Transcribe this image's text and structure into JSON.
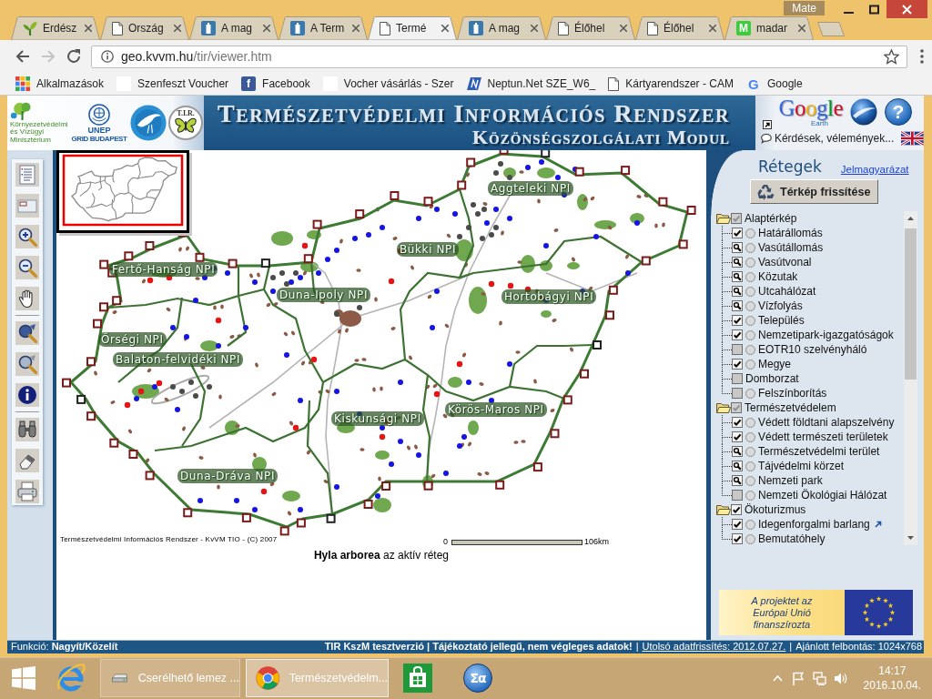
{
  "browser": {
    "user": "Mate",
    "tabs": [
      {
        "title": "Erdész",
        "kind": "sprout",
        "selected": false
      },
      {
        "title": "Ország",
        "kind": "document",
        "selected": false
      },
      {
        "title": "A mag",
        "kind": "statue",
        "selected": false
      },
      {
        "title": "A Term",
        "kind": "statue",
        "selected": false
      },
      {
        "title": "Termé",
        "kind": "document",
        "selected": true
      },
      {
        "title": "A mag",
        "kind": "statue",
        "selected": false
      },
      {
        "title": "Élőhel",
        "kind": "document",
        "selected": false
      },
      {
        "title": "Élőhel",
        "kind": "document",
        "selected": false
      },
      {
        "title": "madar",
        "kind": "square_letter",
        "glyph": "M",
        "color": "#3ccd3c",
        "selected": false
      }
    ],
    "address": {
      "host": "geo.kvvm.hu",
      "path": "/tir/viewer.htm"
    },
    "bookmarks": [
      {
        "label": "Alkalmazások",
        "kind": "apps"
      },
      {
        "label": "Szenfeszt Voucher",
        "kind": "blank"
      },
      {
        "label": "Facebook",
        "kind": "square_letter",
        "glyph": "f",
        "color": "#3b5998"
      },
      {
        "label": "Vocher vásárlás - Szer",
        "kind": "blank"
      },
      {
        "label": "Neptun.Net SZE_W6_",
        "kind": "neptun"
      },
      {
        "label": "Kártyarendszer - CAM",
        "kind": "document"
      },
      {
        "label": "Google",
        "kind": "letter",
        "glyph": "G",
        "color": "#4285f4"
      }
    ]
  },
  "header": {
    "ministry": "Környezetvédelmi és Vízügyi Minisztérium",
    "unep": "UNEP",
    "unep_sub": "GRID BUDAPEST",
    "tir": "T.I.R.",
    "title": "Természetvédelmi Információs Rendszer",
    "subtitle": "Közönségszolgálati Modul",
    "google": "Google",
    "earth": "Earth",
    "help": "?",
    "feedback": "Kérdések, vélemények..."
  },
  "map": {
    "labels": [
      "Aggteleki NPI",
      "Bükki NPI",
      "Fertő-Hanság NPI",
      "Duna-Ipoly NPI",
      "Hortobágyi NPI",
      "Őrségi NPI",
      "Balaton-felvidéki NPI",
      "Kiskunsági NPI",
      "Körös-Maros NPI",
      "Duna-Dráva NPI"
    ],
    "copyright": "Természetvédelmi Információs Rendszer - KvVM TIO - (C) 2007",
    "scale_start": "0",
    "scale_end": "106km",
    "active_layer": "**Hyla arborea** az aktív réteg"
  },
  "layers": {
    "title": "Rétegek",
    "legend_link": "Jelmagyarázat",
    "refresh_button": "Térkép frissítése",
    "groups": [
      {
        "label": "Alaptérkép",
        "checked": true,
        "partial": true,
        "expanded": true,
        "children": [
          {
            "label": "Határállomás",
            "checked": true,
            "out_of_scale": false,
            "selected": false
          },
          {
            "label": "Vasútállomás",
            "checked": true,
            "out_of_scale": true,
            "selected": false
          },
          {
            "label": "Vasútvonal",
            "checked": true,
            "out_of_scale": true,
            "selected": false
          },
          {
            "label": "Közutak",
            "checked": true,
            "out_of_scale": true,
            "selected": false
          },
          {
            "label": "Utcahálózat",
            "checked": true,
            "out_of_scale": true,
            "selected": false
          },
          {
            "label": "Vízfolyás",
            "checked": true,
            "out_of_scale": true,
            "selected": false
          },
          {
            "label": "Település",
            "checked": true,
            "out_of_scale": false,
            "selected": false
          },
          {
            "label": "Nemzetipark-igazgatóságok",
            "checked": true,
            "out_of_scale": false,
            "selected": false
          },
          {
            "label": "EOTR10 szelvényháló",
            "checked": false,
            "out_of_scale": false,
            "selected": false
          },
          {
            "label": "Megye",
            "checked": true,
            "out_of_scale": false,
            "selected": false
          },
          {
            "label": "Domborzat",
            "checked": false,
            "out_of_scale": false
          },
          {
            "label": "Felszínborítás",
            "checked": false,
            "out_of_scale": false,
            "selected": false
          }
        ]
      },
      {
        "label": "Természetvédelem",
        "checked": true,
        "partial": true,
        "expanded": true,
        "children": [
          {
            "label": "Védett földtani alapszelvény",
            "checked": true,
            "out_of_scale": false,
            "selected": false
          },
          {
            "label": "Védett természeti területek",
            "checked": true,
            "out_of_scale": false,
            "selected": false
          },
          {
            "label": "Természetvédelmi terület",
            "checked": true,
            "out_of_scale": true,
            "selected": false
          },
          {
            "label": "Tájvédelmi körzet",
            "checked": true,
            "out_of_scale": true,
            "selected": false
          },
          {
            "label": "Nemzeti park",
            "checked": true,
            "out_of_scale": true,
            "selected": false
          },
          {
            "label": "Nemzeti Ökológiai Hálózat",
            "checked": false,
            "out_of_scale": false,
            "selected": false
          }
        ]
      },
      {
        "label": "Ökoturizmus",
        "checked": true,
        "partial": false,
        "expanded": true,
        "children": [
          {
            "label": "Idegenforgalmi barlang",
            "checked": true,
            "out_of_scale": false,
            "selected": false,
            "external_link": true
          },
          {
            "label": "Bemutatóhely",
            "checked": true,
            "out_of_scale": false,
            "selected": false
          }
        ]
      }
    ]
  },
  "eu_banner": {
    "text": "A projektet az Európai Unió finanszírozta"
  },
  "status_bar": {
    "function": "Funkció: **Nagyít/Közelít**",
    "separator": "|",
    "segments": [
      {
        "text": "TIR KszM tesztverzió | Tájékoztató jellegű, nem végleges adatok!",
        "kind": "notice"
      },
      {
        "text": "Utolsó adatfrissítés: 2012.07.27.",
        "kind": "link"
      },
      {
        "text": "Ajánlott felbontás: 1024x768",
        "kind": "plain"
      }
    ]
  },
  "taskbar": {
    "tasks": [
      {
        "label": "Cserélhető lemez ...",
        "kind": "drive",
        "selected": false
      },
      {
        "label": "Természetvédelm...",
        "kind": "chrome",
        "selected": true
      }
    ],
    "math_glyph": "Σα",
    "time": "14:17",
    "date": "2016.10.04."
  }
}
